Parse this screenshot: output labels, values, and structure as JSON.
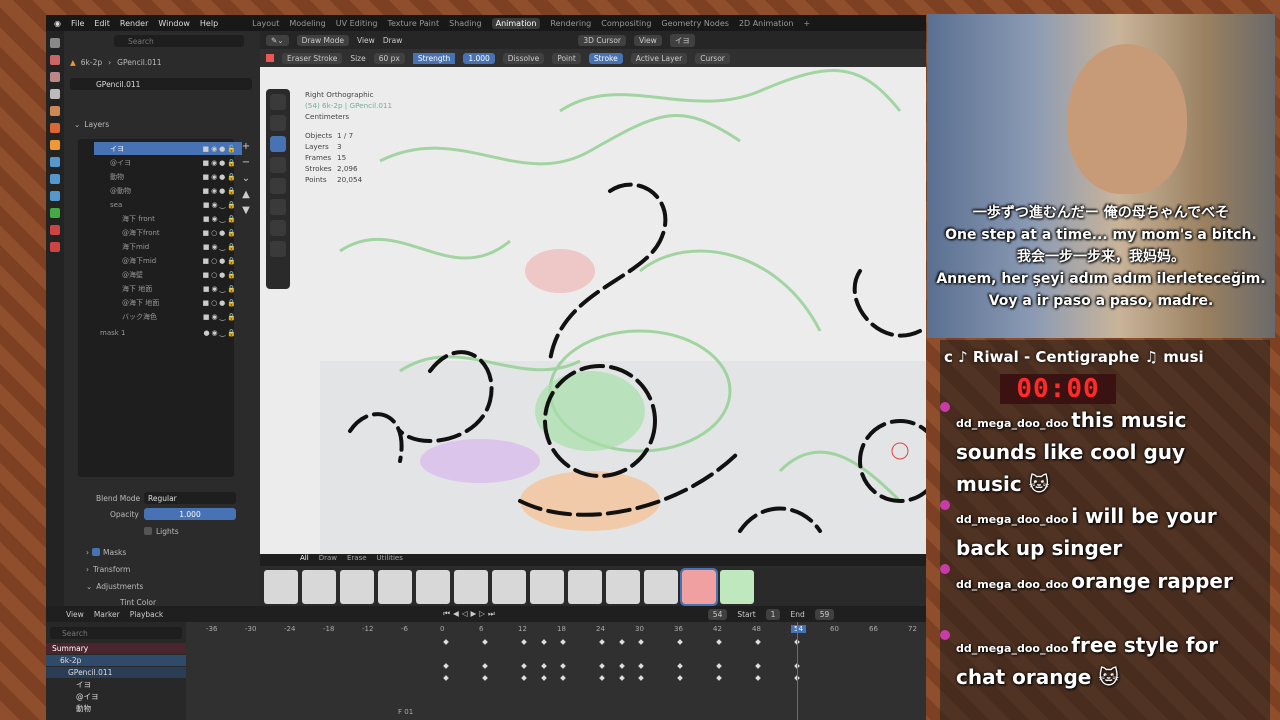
{
  "topbar": {
    "menus": [
      "File",
      "Edit",
      "Render",
      "Window",
      "Help"
    ],
    "workspaces": [
      "Layout",
      "Modeling",
      "UV Editing",
      "Texture Paint",
      "Shading",
      "Animation",
      "Rendering",
      "Compositing",
      "Geometry Nodes",
      "2D Animation"
    ],
    "active_workspace": "Animation"
  },
  "props": {
    "search_placeholder": "Search",
    "object_name": "6k-2p",
    "data_name": "GPencil.011",
    "gp_data": "GPencil.011",
    "layers_title": "Layers",
    "layers": [
      "イヨ",
      "@イヨ",
      "動物",
      "@動物",
      "sea",
      "海下 front",
      "@海下front",
      "海下mid",
      "@海下mid",
      "@海壁",
      "海下 地面",
      "@海下 地面",
      "バック海色",
      "mask 1"
    ],
    "blend_mode_label": "Blend Mode",
    "blend_mode": "Regular",
    "opacity_label": "Opacity",
    "opacity": "1.000",
    "lights_label": "Lights",
    "masks_label": "Masks",
    "transform_label": "Transform",
    "adjustments_label": "Adjustments",
    "tint_label": "Tint Color"
  },
  "viewport": {
    "mode": "Draw Mode",
    "view_menu": "View",
    "draw_menu": "Draw",
    "cursor_menu": "3D Cursor",
    "view2": "View",
    "layer_sel": "イヨ",
    "brush": "Eraser Stroke",
    "size_label": "Size",
    "size_value": "60 px",
    "strength_label": "Strength",
    "strength_value": "1.000",
    "opts": [
      "Dissolve",
      "Point",
      "Stroke"
    ],
    "active_layer": "Active Layer",
    "cursor": "Cursor",
    "stats": {
      "view": "Right Orthographic",
      "obj": "(54) 6k-2p | GPencil.011",
      "unit": "Centimeters",
      "rows": [
        [
          "Objects",
          "1 / 7"
        ],
        [
          "Layers",
          "3"
        ],
        [
          "Frames",
          "15"
        ],
        [
          "Strokes",
          "2,096"
        ],
        [
          "Points",
          "20,054"
        ]
      ]
    },
    "brush_tabs": [
      "All",
      "Draw",
      "Erase",
      "Utilities"
    ]
  },
  "timeline": {
    "menus": [
      "View",
      "Marker",
      "Playback"
    ],
    "current_frame": "54",
    "start_label": "Start",
    "start": "1",
    "end_label": "End",
    "end": "59",
    "search_placeholder": "Search",
    "ticks": [
      "-36",
      "-30",
      "-24",
      "-18",
      "-12",
      "-6",
      "0",
      "6",
      "12",
      "18",
      "24",
      "30",
      "36",
      "42",
      "48",
      "54",
      "60",
      "66",
      "72"
    ],
    "rows": [
      "Summary",
      "6k-2p",
      "GPencil.011",
      "イヨ",
      "@イヨ",
      "動物"
    ],
    "frame_label": "F 01"
  },
  "overlay": {
    "subtitles": [
      "一歩ずつ進むんだー 俺の母ちゃんでべそ",
      "One step at a time... my mom's a bitch.",
      "我会一步一步来，我妈妈。",
      "Annem, her şeyi adım adım ilerleteceğim.",
      "Voy a ir paso a paso, madre."
    ],
    "music": "c ♪ Riwal - Centigraphe    ♫ musi",
    "timer": "00:00",
    "chat": [
      {
        "user": "dd_mega_doo_doo",
        "text": "this music sounds like cool guy music 🐱"
      },
      {
        "user": "dd_mega_doo_doo",
        "text": "i will be your back up singer"
      },
      {
        "user": "dd_mega_doo_doo",
        "text": "orange rapper"
      },
      {
        "user": "dd_mega_doo_doo",
        "text": "free style for chat orange 🐱"
      }
    ]
  }
}
